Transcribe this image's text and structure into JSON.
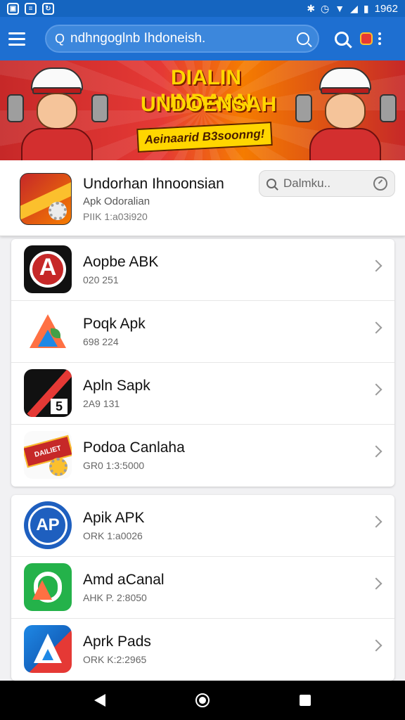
{
  "status_bar": {
    "time": "1962",
    "left_icons": [
      "image-icon",
      "notes-icon",
      "sync-icon"
    ],
    "right_icons": [
      "bluetooth-icon",
      "alarm-icon",
      "wifi-icon",
      "signal-icon",
      "battery-icon"
    ]
  },
  "app_bar": {
    "search_value": "ndhngoglnb Ihdoneish.",
    "search_prefix": "Q",
    "icons": [
      "menu-icon",
      "search-icon",
      "flag-icon",
      "more-vert-icon"
    ]
  },
  "banner": {
    "title_line1": "DIALIN UNDAAN",
    "title_line2": "UNDOENSAH",
    "ribbon": "Aeinaarid B3soonng!",
    "colors": {
      "primary": "#e53935",
      "accent": "#ffd600"
    }
  },
  "featured": {
    "name": "Undorhan Ihnoonsian",
    "subtitle": "Apk Odoralian",
    "meta": "PIIK 1:a03i920",
    "search_value": "Dalmku.."
  },
  "list1": [
    {
      "name": "Aopbe ABK",
      "meta": "020 251",
      "icon": "a-circle-icon"
    },
    {
      "name": "Poqk Apk",
      "meta": "698 224",
      "icon": "colorful-triangle-icon"
    },
    {
      "name": "Apln Sapk",
      "meta": "2A9 131",
      "icon": "red-slash-icon"
    },
    {
      "name": "Podoa Canlaha",
      "meta": "GR0 1:3:5000",
      "icon": "red-badge-gear-icon"
    }
  ],
  "list2": [
    {
      "name": "Apik APK",
      "meta": "ORK 1:a0026",
      "icon": "ap-circle-icon"
    },
    {
      "name": "Amd aCanal",
      "meta": "AHK P. 2:8050",
      "icon": "green-p-icon"
    },
    {
      "name": "Aprk Pads",
      "meta": "ORK K:2:2965",
      "icon": "blue-a-icon"
    }
  ],
  "colors": {
    "app_bar": "#1e6fd1",
    "status_bar": "#1565c0",
    "background": "#f1f1f3"
  }
}
